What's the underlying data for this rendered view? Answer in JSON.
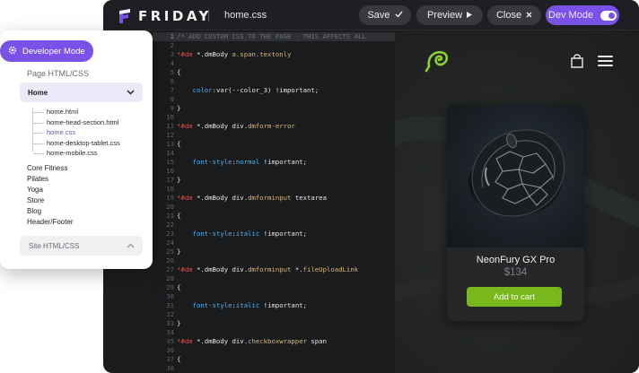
{
  "topbar": {
    "logo_text": "FRIDAY",
    "file_name": "home.css",
    "save_label": "Save",
    "preview_label": "Preview",
    "close_label": "Close",
    "devmode_label": "Dev Mode",
    "devmode_on": true
  },
  "sidebar": {
    "dev_mode_label": "Developer Mode",
    "page_section_title": "Page HTML/CSS",
    "current_page": "Home",
    "files": [
      {
        "name": "home.html",
        "active": false
      },
      {
        "name": "home-head-section.html",
        "active": false
      },
      {
        "name": "home.css",
        "active": true
      },
      {
        "name": "home-desktop-tablet.css",
        "active": false
      },
      {
        "name": "home-mobile.css",
        "active": false
      }
    ],
    "pages": [
      "Core Fitness",
      "Pilates",
      "Yoga",
      "Store",
      "Blog",
      "Header/Footer"
    ],
    "site_section_title": "Site HTML/CSS"
  },
  "code": {
    "lines": [
      {
        "n": "1",
        "parts": [
          [
            "c-comment",
            "/* ADD CUSTOM CSS TO THE PAGE - THIS AFFECTS ALL"
          ]
        ]
      },
      {
        "n": "2",
        "parts": []
      },
      {
        "n": "3",
        "parts": [
          [
            "c-red",
            "*#dm"
          ],
          [
            "c-white",
            " *.dmBody "
          ],
          [
            "c-sel",
            "a.span.textonly"
          ]
        ]
      },
      {
        "n": "4",
        "parts": []
      },
      {
        "n": "5",
        "parts": [
          [
            "c-white",
            "{"
          ]
        ]
      },
      {
        "n": "6",
        "parts": []
      },
      {
        "n": "7",
        "parts": [
          [
            "c-white",
            "    "
          ],
          [
            "c-prop",
            "color"
          ],
          [
            "c-white",
            ":var(--color_3) !important;"
          ]
        ]
      },
      {
        "n": "8",
        "parts": []
      },
      {
        "n": "9",
        "parts": [
          [
            "c-white",
            "}"
          ]
        ]
      },
      {
        "n": "10",
        "parts": []
      },
      {
        "n": "11",
        "parts": [
          [
            "c-red",
            "*#dm"
          ],
          [
            "c-white",
            " *.dmBody div."
          ],
          [
            "c-sel",
            "dmform-error"
          ]
        ]
      },
      {
        "n": "12",
        "parts": []
      },
      {
        "n": "13",
        "parts": [
          [
            "c-white",
            "{"
          ]
        ]
      },
      {
        "n": "14",
        "parts": []
      },
      {
        "n": "15",
        "parts": [
          [
            "c-white",
            "    "
          ],
          [
            "c-prop",
            "font-style"
          ],
          [
            "c-white",
            ":"
          ],
          [
            "c-prop",
            "normal"
          ],
          [
            "c-white",
            " !important;"
          ]
        ]
      },
      {
        "n": "16",
        "parts": []
      },
      {
        "n": "17",
        "parts": [
          [
            "c-white",
            "}"
          ]
        ]
      },
      {
        "n": "18",
        "parts": []
      },
      {
        "n": "19",
        "parts": [
          [
            "c-red",
            "*#dm"
          ],
          [
            "c-white",
            " *.dmBody div."
          ],
          [
            "c-sel",
            "dmforminput"
          ],
          [
            "c-white",
            " textarea"
          ]
        ]
      },
      {
        "n": "20",
        "parts": []
      },
      {
        "n": "21",
        "parts": [
          [
            "c-white",
            "{"
          ]
        ]
      },
      {
        "n": "22",
        "parts": []
      },
      {
        "n": "23",
        "parts": [
          [
            "c-white",
            "    "
          ],
          [
            "c-prop",
            "font-style"
          ],
          [
            "c-white",
            ":"
          ],
          [
            "c-prop",
            "italic"
          ],
          [
            "c-white",
            " !important;"
          ]
        ]
      },
      {
        "n": "24",
        "parts": []
      },
      {
        "n": "25",
        "parts": [
          [
            "c-white",
            "}"
          ]
        ]
      },
      {
        "n": "26",
        "parts": []
      },
      {
        "n": "27",
        "parts": [
          [
            "c-red",
            "*#dm"
          ],
          [
            "c-white",
            " *.dmBody div."
          ],
          [
            "c-sel",
            "dmforminput"
          ],
          [
            "c-white",
            " *."
          ],
          [
            "c-sel",
            "fileUploadLink"
          ]
        ]
      },
      {
        "n": "28",
        "parts": []
      },
      {
        "n": "29",
        "parts": [
          [
            "c-white",
            "{"
          ]
        ]
      },
      {
        "n": "30",
        "parts": []
      },
      {
        "n": "31",
        "parts": [
          [
            "c-white",
            "    "
          ],
          [
            "c-prop",
            "font-style"
          ],
          [
            "c-white",
            ":"
          ],
          [
            "c-prop",
            "italic"
          ],
          [
            "c-white",
            " !important;"
          ]
        ]
      },
      {
        "n": "32",
        "parts": []
      },
      {
        "n": "33",
        "parts": [
          [
            "c-white",
            "}"
          ]
        ]
      },
      {
        "n": "34",
        "parts": []
      },
      {
        "n": "35",
        "parts": [
          [
            "c-red",
            "*#dm"
          ],
          [
            "c-white",
            " *.dmBody div."
          ],
          [
            "c-sel",
            "checkboxwrapper"
          ],
          [
            "c-white",
            " span"
          ]
        ]
      },
      {
        "n": "36",
        "parts": []
      },
      {
        "n": "37",
        "parts": [
          [
            "c-white",
            "{"
          ]
        ]
      },
      {
        "n": "38",
        "parts": []
      }
    ]
  },
  "preview": {
    "product_name": "NeonFury GX Pro",
    "product_price": "$134",
    "cta_label": "Add to cart",
    "accent_color": "#78b81c"
  },
  "colors": {
    "brand_purple": "#7a52e8",
    "editor_bg": "#1b1c1e"
  }
}
